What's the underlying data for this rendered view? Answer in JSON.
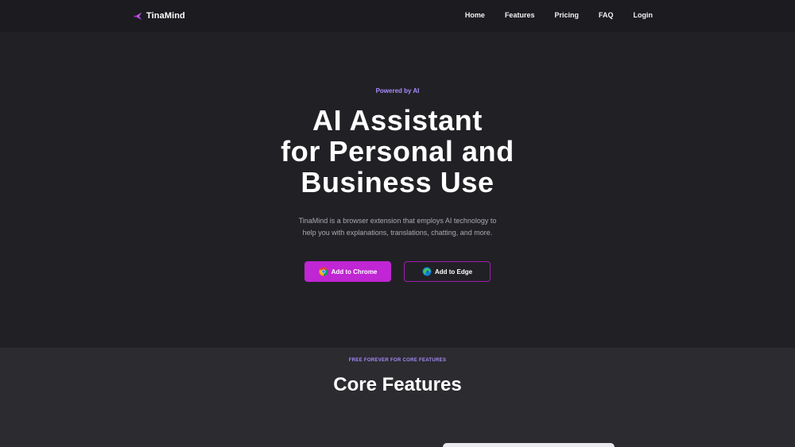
{
  "nav": {
    "brand_name": "TinaMind",
    "logo_icon": "tinamind-logo-icon",
    "links": [
      "Home",
      "Features",
      "Pricing",
      "FAQ",
      "Login"
    ]
  },
  "hero": {
    "eyebrow": "Powered by AI",
    "headline_lines": [
      "AI Assistant",
      "for Personal and",
      "Business Use"
    ],
    "subtext_lines": [
      "TinaMind is a browser extension that employs AI technology to",
      "help you with explanations, translations, chatting, and more."
    ],
    "cta_chrome": {
      "label": "Add to Chrome",
      "icon": "chrome-icon"
    },
    "cta_edge": {
      "label": "Add to Edge",
      "icon": "edge-icon"
    }
  },
  "features": {
    "eyebrow": "FREE FOREVER FOR CORE FEATURES",
    "title": "Core Features"
  },
  "colors": {
    "background": "#212125",
    "nav_background": "#1c1c20",
    "section_background": "#2b2b30",
    "accent_purple": "#c026d3",
    "eyebrow_purple": "#a78bfa",
    "edge_border": "#a21caf"
  }
}
